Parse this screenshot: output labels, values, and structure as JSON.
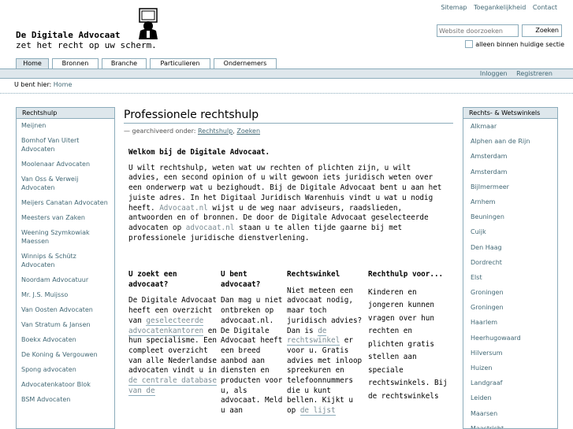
{
  "site_actions": [
    "Sitemap",
    "Toegankelijkheid",
    "Contact"
  ],
  "logo": {
    "line1": "De Digitale Advocaat",
    "line2": "zet het recht op uw scherm."
  },
  "search": {
    "placeholder": "Website doorzoeken",
    "button": "Zoeken",
    "option": "alleen binnen huidige sectie"
  },
  "tabs": [
    "Home",
    "Bronnen",
    "Branche",
    "Particulieren",
    "Ondernemers"
  ],
  "personal": [
    "Inloggen",
    "Registreren"
  ],
  "breadcrumb": {
    "prefix": "U bent hier:",
    "home": "Home"
  },
  "left_portlet": {
    "title": "Rechtshulp",
    "items": [
      "Meijnen",
      "Bomhof Van Uitert Advocaten",
      "Moolenaar Advocaten",
      "Van Oss & Verweij Advocaten",
      "Meijers Canatan Advocaten",
      "Meesters van Zaken",
      "Weening Szymkowiak Maessen",
      "Winnips & Schütz Advocaten",
      "Noordam Advocatuur",
      "Mr. J.S. Muijsso",
      "Van Oosten Advocaten",
      "Van Stratum & Jansen",
      "Boekx Advocaten",
      "De Koning & Vergouwen",
      "Spong advocaten",
      "Advocatenkatoor Blok",
      "BSM Advocaten"
    ]
  },
  "right_portlet": {
    "title": "Rechts- & Wetswinkels",
    "items": [
      "Alkmaar",
      "Alphen aan de Rijn",
      "Amsterdam",
      "Amsterdam",
      "Bijlmermeer",
      "Arnhem",
      "Beuningen",
      "Cuijk",
      "Den Haag",
      "Dordrecht",
      "Elst",
      "Groningen",
      "Groningen",
      "Haarlem",
      "Heerhugowaard",
      "Hilversum",
      "Huizen",
      "Landgraaf",
      "Leiden",
      "Maarsen",
      "Maastricht"
    ]
  },
  "content": {
    "title": "Professionele rechtshulp",
    "byline_prefix": "— gearchiveerd onder:",
    "byline_link1": "Rechtshulp",
    "byline_sep": ",",
    "byline_link2": "Zoeken",
    "welcome": "Welkom bij de Digitale Advocaat.",
    "intro_1": "U wilt rechtshulp, weten wat uw rechten of plichten zijn, u wilt advies, een second opinion of u wilt gewoon iets juridisch weten over een onderwerp wat u bezighoudt. Bij de Digitale Advocaat bent u aan het juiste adres. In het Digitaal Juridisch Warenhuis vindt u wat u nodig heeft.",
    "intro_link1": "Advocaat.nl",
    "intro_2": "wijst u de weg naar adviseurs, raadslieden, antwoorden en of bronnen. De door de Digitale Advocaat geselecteerde advocaten op",
    "intro_link2": "advocaat.nl",
    "intro_3": "staan u te allen tijde gaarne bij met professionele juridische dienstverlening.",
    "col1": {
      "title": "U zoekt een advocaat?",
      "text1": "De Digitale Advocaat heeft een overzicht van",
      "link1": "geselecteerde advocatenkantoren",
      "text2": "en hun specialisme. Een compleet overzicht van alle Nederlandse advocaten vindt u in",
      "link2": "de centrale database van de"
    },
    "col2": {
      "title": "U bent advocaat?",
      "text1": "Dan mag u niet ontbreken op advocaat.nl. De Digitale Advocaat heeft een breed aanbod aan diensten en producten voor u, als advocaat. Meld u aan"
    },
    "col3": {
      "title": "Rechtswinkel",
      "text1": "Niet meteen een advocaat nodig, maar toch juridisch advies? Dan is",
      "link1": "de rechtswinkel",
      "text2": "er voor u. Gratis advies met inloop spreekuren en telefoonnummers die u kunt bellen. Kijkt u op",
      "link2": "de lijst"
    },
    "col4": {
      "title": "Rechthulp voor...",
      "text1": "Kinderen en jongeren kunnen vragen over hun rechten en plichten gratis stellen aan speciale rechtswinkels. Bij de rechtswinkels"
    }
  }
}
